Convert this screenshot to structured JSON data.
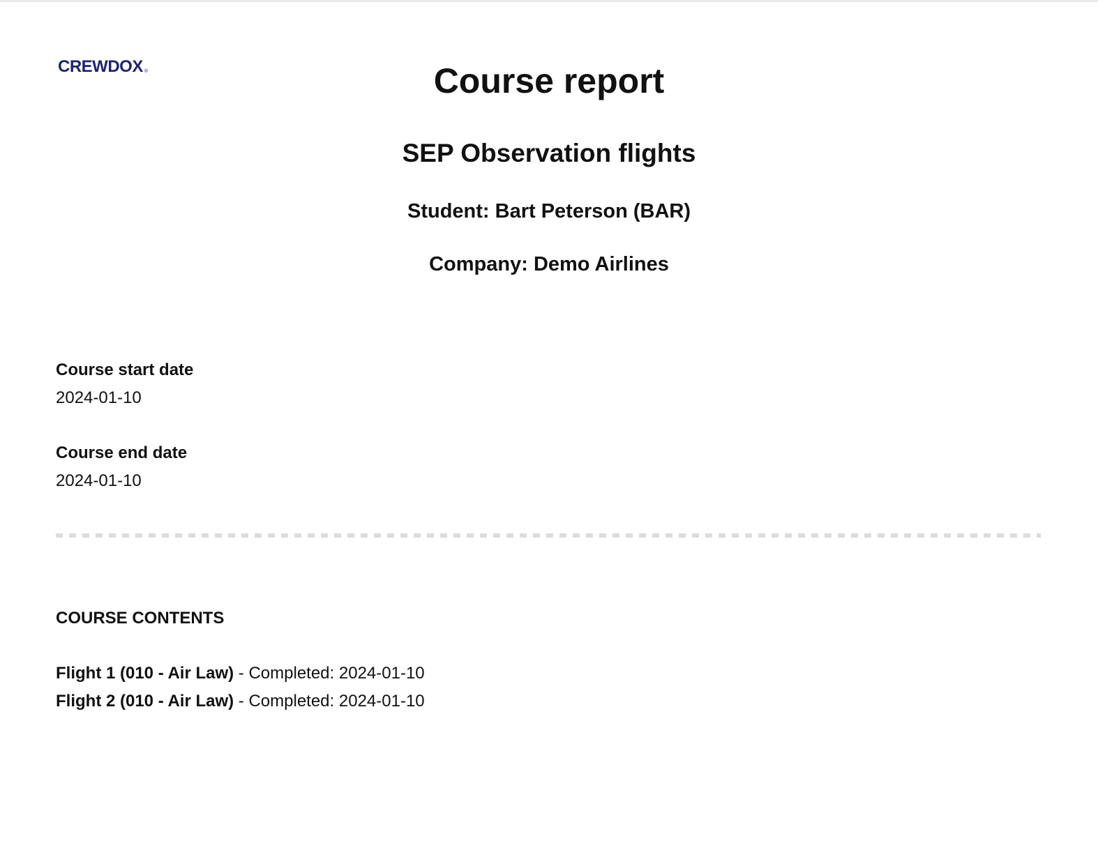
{
  "logo": {
    "text": "CREWDOX",
    "mark": "®"
  },
  "report": {
    "title": "Course report",
    "course_name": "SEP Observation flights",
    "student_line": "Student: Bart Peterson (BAR)",
    "company_line": "Company: Demo Airlines"
  },
  "fields": {
    "start_label": "Course start date",
    "start_value": "2024-01-10",
    "end_label": "Course end date",
    "end_value": "2024-01-10"
  },
  "contents": {
    "heading": "COURSE CONTENTS",
    "items": [
      {
        "name": "Flight 1 (010 - Air Law)",
        "status": " - Completed: 2024-01-10"
      },
      {
        "name": "Flight 2 (010 - Air Law)",
        "status": " - Completed: 2024-01-10"
      }
    ]
  },
  "colors": {
    "brand": "#1f2470",
    "divider": "#dcdcdc",
    "text": "#111111"
  }
}
